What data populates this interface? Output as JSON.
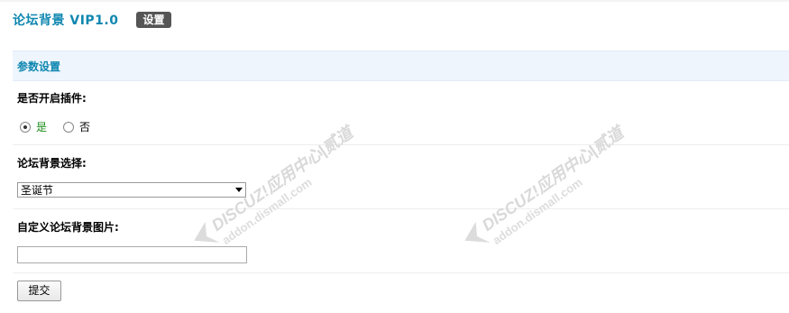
{
  "header": {
    "title": "论坛背景  VIP1.0",
    "settings_button": "设置"
  },
  "section": {
    "title": "参数设置"
  },
  "plugin_toggle": {
    "label": "是否开启插件:",
    "option_yes": "是",
    "option_no": "否",
    "selected": "是"
  },
  "background_select": {
    "label": "论坛背景选择:",
    "selected_value": "圣诞节"
  },
  "custom_image": {
    "label": "自定义论坛背景图片:",
    "value": ""
  },
  "submit_label": "提交",
  "watermark": {
    "line1": "DISCUZ!应用中心|贰道",
    "line2": "addon.dismall.com"
  },
  "colors": {
    "title": "#0f87b0",
    "section_bg": "#eef5fd",
    "settings_button_bg": "#555555",
    "yes_option": "#1a8a1a"
  }
}
